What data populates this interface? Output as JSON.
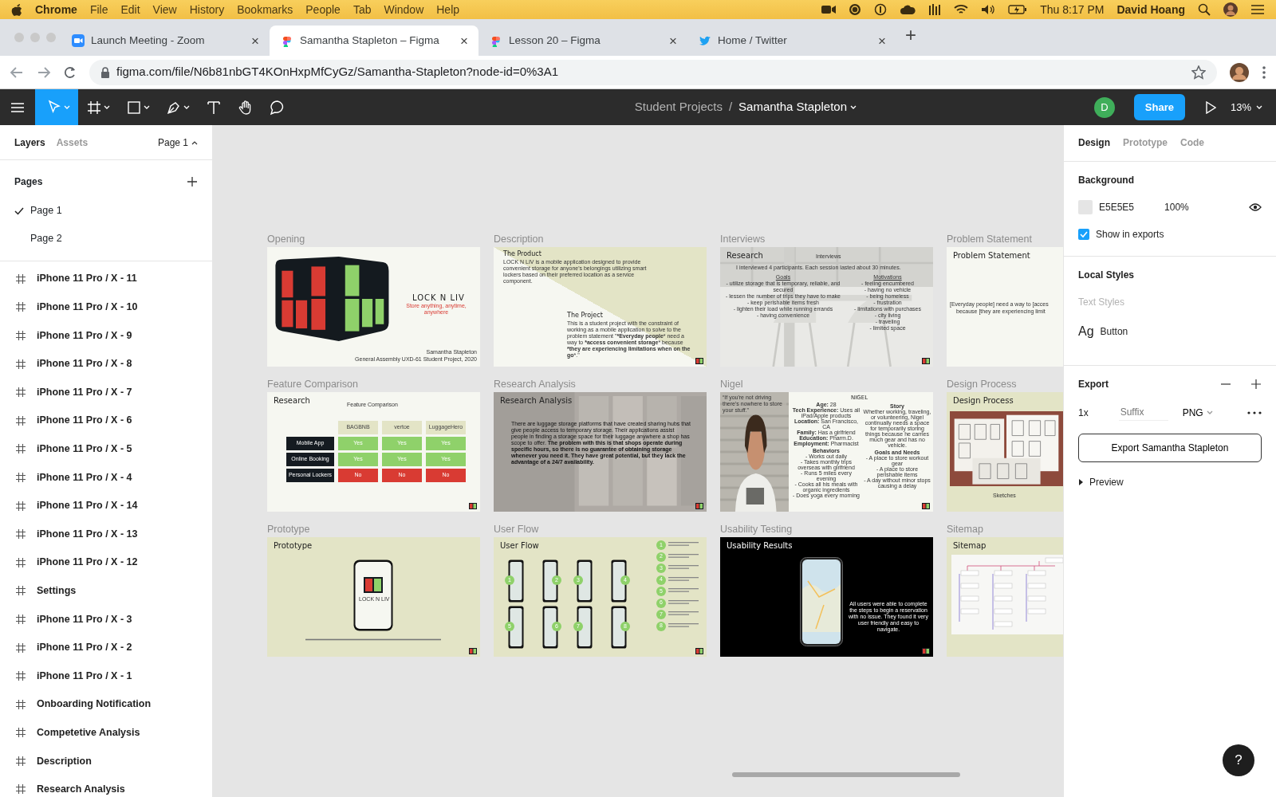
{
  "menubar": {
    "app": "Chrome",
    "menus": [
      "File",
      "Edit",
      "View",
      "History",
      "Bookmarks",
      "People",
      "Tab",
      "Window",
      "Help"
    ],
    "clock": "Thu 8:17 PM",
    "user": "David Hoang"
  },
  "browser_tabs": [
    {
      "title": "Launch Meeting - Zoom",
      "kind": "zoom",
      "selected": false,
      "close": "×"
    },
    {
      "title": "Samantha Stapleton – Figma",
      "kind": "figma",
      "selected": true,
      "close": "×"
    },
    {
      "title": "Lesson 20 – Figma",
      "kind": "figma",
      "selected": false,
      "close": "×"
    },
    {
      "title": "Home / Twitter",
      "kind": "twitter",
      "selected": false,
      "close": "×"
    }
  ],
  "new_tab": "+",
  "address": "figma.com/file/N6b81nbGT4KOnHxpMfCyGz/Samantha-Stapleton?node-id=0%3A1",
  "toolbar": {
    "tools": [
      {
        "kind": "move",
        "selected": true
      },
      {
        "kind": "frame",
        "selected": false
      },
      {
        "kind": "shape",
        "selected": false
      },
      {
        "kind": "pen",
        "selected": false
      },
      {
        "kind": "text",
        "selected": false
      },
      {
        "kind": "hand",
        "selected": false
      },
      {
        "kind": "comment",
        "selected": false
      }
    ],
    "project": "Student Projects",
    "separator": "/",
    "file": "Samantha Stapleton",
    "avatar": "D",
    "share": "Share",
    "zoom": "13%"
  },
  "left_panel": {
    "tabs": [
      {
        "label": "Layers",
        "selected": true
      },
      {
        "label": "Assets",
        "selected": false
      }
    ],
    "page_menu": "Page 1",
    "pages_title": "Pages",
    "pages": [
      {
        "name": "Page 1",
        "selected": true
      },
      {
        "name": "Page 2",
        "selected": false
      }
    ],
    "layers": [
      "iPhone 11 Pro / X - 11",
      "iPhone 11 Pro / X - 10",
      "iPhone 11 Pro / X - 9",
      "iPhone 11 Pro / X - 8",
      "iPhone 11 Pro / X - 7",
      "iPhone 11 Pro / X - 6",
      "iPhone 11 Pro / X - 5",
      "iPhone 11 Pro / X - 4",
      "iPhone 11 Pro / X - 14",
      "iPhone 11 Pro / X - 13",
      "iPhone 11 Pro / X - 12",
      "Settings",
      "iPhone 11 Pro / X - 3",
      "iPhone 11 Pro / X - 2",
      "iPhone 11 Pro / X - 1",
      "Onboarding Notification",
      "Competetive Analysis",
      "Description",
      "Research Analysis"
    ]
  },
  "frames": [
    {
      "label": "Opening",
      "kind": "opening",
      "brand": "LOCK N LIV",
      "tagline": "Store anything, anytime, anywhere",
      "credits": [
        "Samantha Stapleton",
        "General Assembly UXD-61 Student Project, 2020"
      ]
    },
    {
      "label": "Description",
      "kind": "description",
      "corner_logo": true,
      "sections": [
        {
          "title": "The Product",
          "text": "LOCK N LIV is a mobile application designed to provide convenient storage for anyone's belongings utilizing smart lockers based on their preferred location as a service component."
        },
        {
          "title": "The Project",
          "text": "This is a student project with the constraint of working as a mobile application to solve to the problem statement \"***Everyday people*** need a way to ***access convenient storage*** because ***they are experiencing limitations when on the go***.\""
        }
      ]
    },
    {
      "label": "Interviews",
      "kind": "interviews",
      "corner_logo": true,
      "title": "Research",
      "subtitle": "Interviews",
      "intro": "I interviewed 4 participants. Each session lasted about 30 minutes.",
      "columns": [
        {
          "heading": "Goals",
          "items": [
            "- utilize storage that is temporary, reliable, and secured",
            "- lessen the number of trips they have to make",
            "- keep perishable items fresh",
            "- lighten their load while running errands",
            "- having convenience"
          ]
        },
        {
          "heading": "Motivations",
          "items": [
            "- feeling encumbered",
            "- having no vehicle",
            "- being homeless",
            "- frustration",
            "- limitations with purchases",
            "- city living",
            "- traveling",
            "- limited space"
          ]
        }
      ]
    },
    {
      "label": "Problem Statement",
      "kind": "statement",
      "title": "Problem Statement",
      "lines": [
        "[Everyday people] need a way to [acces",
        "because [they are experiencing limit"
      ]
    },
    {
      "label": "Feature Comparison",
      "kind": "comparison",
      "corner_logo": true,
      "title": "Research",
      "subtitle": "Feature Comparison",
      "columns": [
        "BAGBNB",
        "vertoe",
        "LuggageHero"
      ],
      "rows": [
        {
          "feature": "Mobile App",
          "cells": [
            {
              "text": "Yes",
              "kind": "yes"
            },
            {
              "text": "Yes",
              "kind": "yes"
            },
            {
              "text": "Yes",
              "kind": "yes"
            }
          ]
        },
        {
          "feature": "Online Booking",
          "cells": [
            {
              "text": "Yes",
              "kind": "yes"
            },
            {
              "text": "Yes",
              "kind": "yes"
            },
            {
              "text": "Yes",
              "kind": "yes"
            }
          ]
        },
        {
          "feature": "Personal Lockers",
          "cells": [
            {
              "text": "No",
              "kind": "no"
            },
            {
              "text": "No",
              "kind": "no"
            },
            {
              "text": "No",
              "kind": "no"
            }
          ]
        }
      ]
    },
    {
      "label": "Research Analysis",
      "kind": "analysis",
      "corner_logo": true,
      "title": "Research Analysis",
      "text": "There are luggage storage platforms that have created sharing hubs that give people access to temporary storage. Their applications assist people in finding a storage space for their luggage anywhere a shop has scope to offer. **The problem with this is that shops operate during specific hours, so there is no guarantee of obtaining storage whenever you need it. They have great potential, but they lack the advantage of a 24/7 availability.**"
    },
    {
      "label": "Nigel",
      "kind": "persona",
      "corner_logo": true,
      "quote": "“If you're not driving there's nowhere to store your stuff.”",
      "name": "NIGEL",
      "facts": [
        "**Age:** 28",
        "**Tech Experience:** Uses all iPad/Apple products",
        "**Location:** San Francisco, CA",
        "**Family:** Has a girlfriend",
        "**Education:** Pharm.D.",
        "**Employment:** Pharmacist"
      ],
      "sections": [
        {
          "heading": "Behaviors",
          "lines": [
            "- Works out daily",
            "- Takes monthly trips overseas with girlfriend",
            "- Runs 5 miles every evening",
            "- Cooks all his meals with organic ingredients",
            "- Does yoga every morning"
          ]
        },
        {
          "heading": "Story",
          "lines": [
            "Whether working, traveling, or volunteering, Nigel continually needs a space for temporarily storing things because he carries much gear and has no vehicle."
          ]
        },
        {
          "heading": "Goals and Needs",
          "lines": [
            "- A place to store workout gear",
            "- A place to store perishable items",
            "- A day without minor stops causing a delay"
          ]
        }
      ]
    },
    {
      "label": "Design Process",
      "kind": "process",
      "title": "Design Process",
      "caption": "Sketches"
    },
    {
      "label": "Prototype",
      "kind": "prototype",
      "corner_logo": true,
      "title": "Prototype",
      "phone_label": "LOCK N LIV"
    },
    {
      "label": "User Flow",
      "kind": "flow",
      "corner_logo": true,
      "title": "User Flow",
      "phones": [
        "1",
        "2",
        "3",
        "4",
        "5",
        "6",
        "7",
        "8"
      ],
      "steps": [
        "1",
        "2",
        "3",
        "4",
        "5",
        "6",
        "7",
        "8"
      ]
    },
    {
      "label": "Usability Testing",
      "kind": "usability",
      "corner_logo": true,
      "title": "Usability Results",
      "text": "All users were able to complete the steps to begin a reservation with no issue. They found it very user friendly and easy to navigate."
    },
    {
      "label": "Sitemap",
      "kind": "sitemap",
      "title": "Sitemap"
    }
  ],
  "right_panel": {
    "tabs": [
      {
        "label": "Design",
        "selected": true
      },
      {
        "label": "Prototype",
        "selected": false
      },
      {
        "label": "Code",
        "selected": false
      }
    ],
    "background": {
      "title": "Background",
      "hex": "E5E5E5",
      "opacity": "100%",
      "show_in_exports": {
        "label": "Show in exports",
        "checked": true
      }
    },
    "local_styles": {
      "title": "Local Styles",
      "subtitle": "Text Styles",
      "styles": [
        {
          "sample": "Ag",
          "name": "Button"
        }
      ]
    },
    "export": {
      "title": "Export",
      "scale": "1x",
      "suffix_placeholder": "Suffix",
      "format": "PNG",
      "button": "Export Samantha Stapleton",
      "preview": "Preview",
      "preview_expanded": false
    }
  },
  "help": "?"
}
